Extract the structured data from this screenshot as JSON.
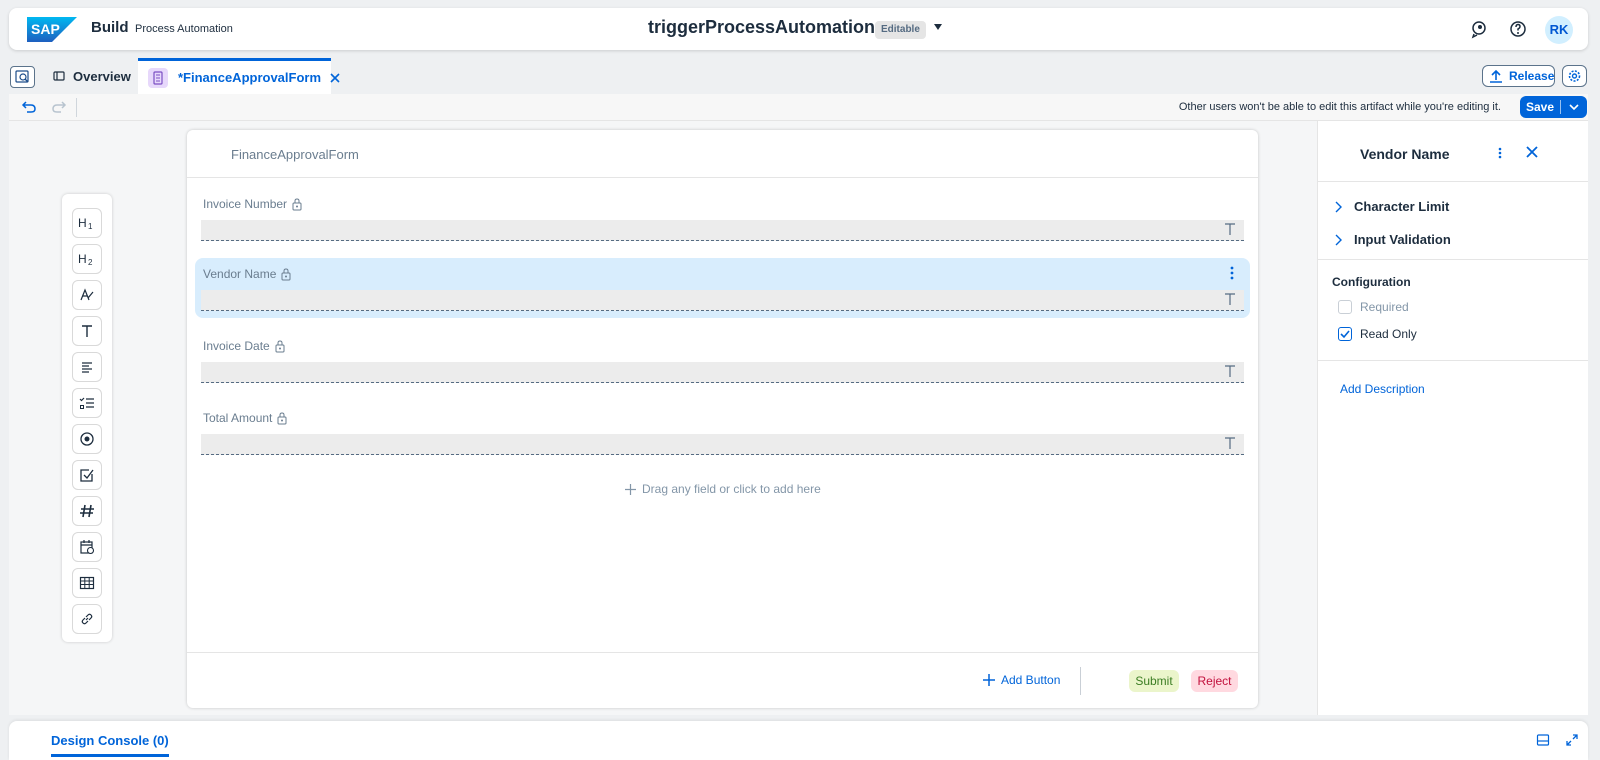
{
  "shell": {
    "brand": "Build",
    "product": "Process Automation",
    "title": "triggerProcessAutomation",
    "status_badge": "Editable",
    "avatar_initials": "RK",
    "icons": [
      "sap-logo",
      "feedback-icon",
      "help-icon"
    ]
  },
  "tabs": {
    "overview_label": "Overview",
    "active_label": "*FinanceApprovalForm",
    "release_label": "Release"
  },
  "toolbar": {
    "info_text": "Other users won't be able to edit this artifact while you're editing it.",
    "save_label": "Save"
  },
  "palette": {
    "items": [
      "heading1-icon",
      "heading2-icon",
      "paragraph-icon",
      "text-field-icon",
      "text-area-icon",
      "checklist-icon",
      "radio-icon",
      "checkbox-icon",
      "number-icon",
      "date-icon",
      "table-icon",
      "link-icon"
    ]
  },
  "form": {
    "title": "FinanceApprovalForm",
    "fields": [
      {
        "label": "Invoice Number",
        "selected": false
      },
      {
        "label": "Vendor Name",
        "selected": true
      },
      {
        "label": "Invoice Date",
        "selected": false
      },
      {
        "label": "Total Amount",
        "selected": false
      }
    ],
    "drag_hint": "Drag any field or click to add here",
    "add_button_label": "Add Button",
    "submit_label": "Submit",
    "reject_label": "Reject"
  },
  "properties": {
    "title": "Vendor Name",
    "sections": [
      "Character Limit",
      "Input Validation"
    ],
    "configuration_heading": "Configuration",
    "required_label": "Required",
    "required_checked": false,
    "read_only_label": "Read Only",
    "read_only_checked": true,
    "add_description_label": "Add Description"
  },
  "console": {
    "tab_label": "Design Console (0)"
  },
  "colors": {
    "accent": "#0064d9",
    "selected_field": "#d8edfd",
    "submit_bg": "#ebf5cb",
    "reject_bg": "#ffd9e0"
  }
}
